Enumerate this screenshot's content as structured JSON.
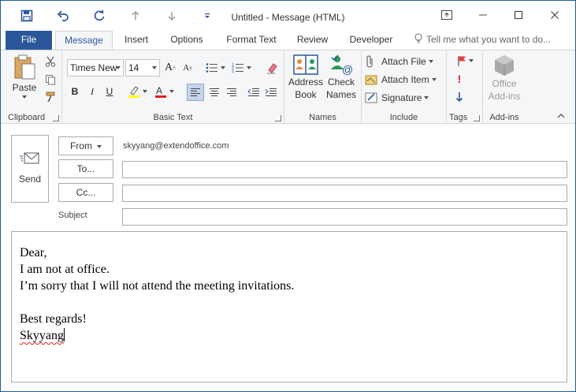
{
  "window": {
    "title": "Untitled - Message (HTML)",
    "accent_color": "#2b579a"
  },
  "quick_access": {
    "icons": [
      "save-icon",
      "undo-icon",
      "redo-icon",
      "up-arrow-icon",
      "down-arrow-icon",
      "customize-dropdown-icon"
    ]
  },
  "tabs": [
    {
      "label": "File"
    },
    {
      "label": "Message"
    },
    {
      "label": "Insert"
    },
    {
      "label": "Options"
    },
    {
      "label": "Format Text"
    },
    {
      "label": "Review"
    },
    {
      "label": "Developer"
    }
  ],
  "active_tab": "Message",
  "tell_me": {
    "placeholder": "Tell me what you want to do..."
  },
  "ribbon": {
    "clipboard": {
      "label": "Clipboard",
      "paste_label": "Paste"
    },
    "basic_text": {
      "label": "Basic Text",
      "font_name": "Times New",
      "font_size": "14",
      "bold_label": "B",
      "italic_label": "I",
      "underline_label": "U"
    },
    "names": {
      "label": "Names",
      "address_book_line1": "Address",
      "address_book_line2": "Book",
      "check_names_line1": "Check",
      "check_names_line2": "Names"
    },
    "include": {
      "label": "Include",
      "attach_file": "Attach File",
      "attach_item": "Attach Item",
      "signature": "Signature"
    },
    "tags": {
      "label": "Tags"
    },
    "addins": {
      "label": "Add-ins",
      "office_addins_line1": "Office",
      "office_addins_line2": "Add-ins"
    }
  },
  "compose": {
    "send_label": "Send",
    "from_label": "From",
    "from_address": "skyyang@extendoffice.com",
    "to_label": "To...",
    "cc_label": "Cc...",
    "subject_label": "Subject",
    "to_value": "",
    "cc_value": "",
    "subject_value": ""
  },
  "message_body": {
    "lines": [
      "Dear,",
      "I am not at office.",
      "I’m sorry that I will not attend the meeting invitations.",
      "",
      "Best regards!",
      "Skyyang"
    ]
  }
}
